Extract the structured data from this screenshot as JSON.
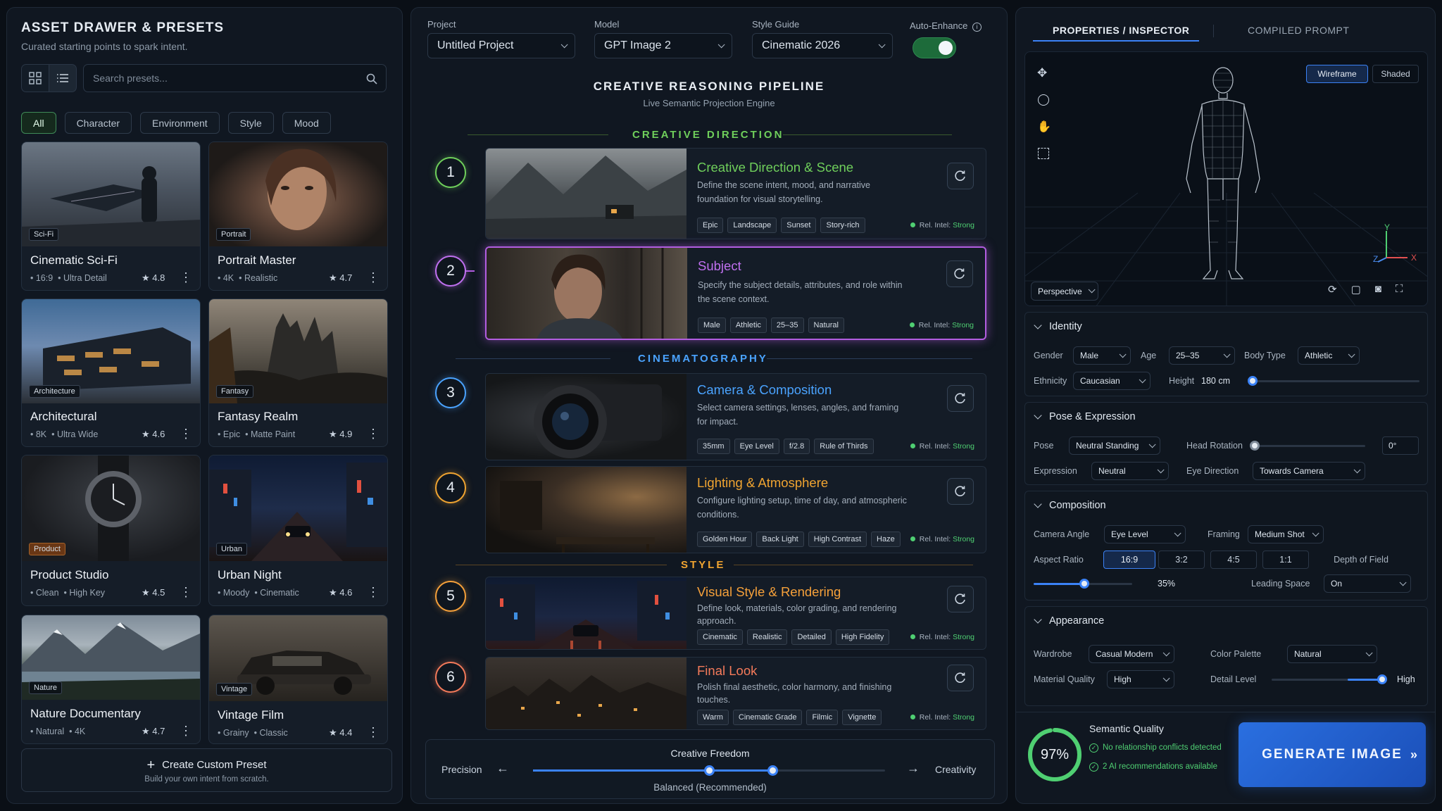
{
  "left": {
    "title": "ASSET DRAWER & PRESETS",
    "subtitle": "Curated starting points to spark intent.",
    "search_placeholder": "Search presets...",
    "filters": [
      "All",
      "Character",
      "Environment",
      "Style",
      "Mood"
    ],
    "presets": [
      {
        "tag": "Sci-Fi",
        "title": "Cinematic Sci-Fi",
        "meta1": "16:9",
        "meta2": "Ultra Detail",
        "rating": "4.8"
      },
      {
        "tag": "Portrait",
        "title": "Portrait Master",
        "meta1": "4K",
        "meta2": "Realistic",
        "rating": "4.7"
      },
      {
        "tag": "Architecture",
        "title": "Architectural",
        "meta1": "8K",
        "meta2": "Ultra Wide",
        "rating": "4.6"
      },
      {
        "tag": "Fantasy",
        "title": "Fantasy Realm",
        "meta1": "Epic",
        "meta2": "Matte Paint",
        "rating": "4.9"
      },
      {
        "tag": "Product",
        "title": "Product Studio",
        "meta1": "Clean",
        "meta2": "High Key",
        "rating": "4.5"
      },
      {
        "tag": "Urban",
        "title": "Urban Night",
        "meta1": "Moody",
        "meta2": "Cinematic",
        "rating": "4.6"
      },
      {
        "tag": "Nature",
        "title": "Nature Documentary",
        "meta1": "Natural",
        "meta2": "4K",
        "rating": "4.7"
      },
      {
        "tag": "Vintage",
        "title": "Vintage Film",
        "meta1": "Grainy",
        "meta2": "Classic",
        "rating": "4.4"
      }
    ],
    "create_title": "Create Custom Preset",
    "create_sub": "Build your own intent from scratch."
  },
  "mid": {
    "labels": {
      "project": "Project",
      "model": "Model",
      "style": "Style Guide",
      "auto": "Auto-Enhance"
    },
    "values": {
      "project": "Untitled Project",
      "model": "GPT Image 2",
      "style": "Cinematic 2026"
    },
    "auto_enhance_on": true,
    "title": "CREATIVE REASONING PIPELINE",
    "subtitle": "Live Semantic Projection Engine",
    "sections": [
      "CREATIVE DIRECTION",
      "CINEMATOGRAPHY",
      "STYLE"
    ],
    "rel_prefix": "Rel. Intel:",
    "steps": [
      {
        "n": "1",
        "title": "Creative Direction & Scene",
        "desc": "Define the scene intent, mood, and narrative foundation for visual storytelling.",
        "chips": [
          "Epic",
          "Landscape",
          "Sunset",
          "Story-rich"
        ],
        "rel": "Strong",
        "color": "#6fcf5b"
      },
      {
        "n": "2",
        "title": "Subject",
        "desc": "Specify the subject details, attributes, and role within the scene context.",
        "chips": [
          "Male",
          "Athletic",
          "25–35",
          "Natural"
        ],
        "rel": "Strong",
        "color": "#c070f0"
      },
      {
        "n": "3",
        "title": "Camera & Composition",
        "desc": "Select camera settings, lenses, angles, and framing for impact.",
        "chips": [
          "35mm",
          "Eye Level",
          "f/2.8",
          "Rule of Thirds"
        ],
        "rel": "Strong",
        "color": "#4aa3ff"
      },
      {
        "n": "4",
        "title": "Lighting & Atmosphere",
        "desc": "Configure lighting setup, time of day, and atmospheric conditions.",
        "chips": [
          "Golden Hour",
          "Back Light",
          "High Contrast",
          "Haze"
        ],
        "rel": "Strong",
        "color": "#f0a431"
      },
      {
        "n": "5",
        "title": "Visual Style & Rendering",
        "desc": "Define look, materials, color grading, and rendering approach.",
        "chips": [
          "Cinematic",
          "Realistic",
          "Detailed",
          "High Fidelity"
        ],
        "rel": "Strong",
        "color": "#f5a03a"
      },
      {
        "n": "6",
        "title": "Final Look",
        "desc": "Polish final aesthetic, color harmony, and finishing touches.",
        "chips": [
          "Warm",
          "Cinematic Grade",
          "Filmic",
          "Vignette"
        ],
        "rel": "Strong",
        "color": "#f47a5a"
      }
    ],
    "slider": {
      "title": "Creative Freedom",
      "left": "Precision",
      "right": "Creativity",
      "caption": "Balanced (Recommended)"
    }
  },
  "right": {
    "tabs": [
      "PROPERTIES / INSPECTOR",
      "COMPILED PROMPT"
    ],
    "view_modes": [
      "Wireframe",
      "Shaded"
    ],
    "perspective": "Perspective",
    "axes": {
      "x": "X",
      "y": "Y",
      "z": "Z"
    },
    "identity": {
      "title": "Identity",
      "gender_l": "Gender",
      "gender": "Male",
      "age_l": "Age",
      "age": "25–35",
      "body_l": "Body Type",
      "body": "Athletic",
      "eth_l": "Ethnicity",
      "eth": "Caucasian",
      "height_l": "Height",
      "height": "180 cm"
    },
    "pose": {
      "title": "Pose & Expression",
      "pose_l": "Pose",
      "pose": "Neutral Standing",
      "head_l": "Head Rotation",
      "head": "0°",
      "expr_l": "Expression",
      "expr": "Neutral",
      "eye_l": "Eye Direction",
      "eye": "Towards Camera"
    },
    "composition": {
      "title": "Composition",
      "angle_l": "Camera Angle",
      "angle": "Eye Level",
      "framing_l": "Framing",
      "framing": "Medium Shot",
      "ar_l": "Aspect Ratio",
      "ratios": [
        "16:9",
        "3:2",
        "4:5",
        "1:1"
      ],
      "dof": "Depth of Field",
      "zoom": "35%",
      "zoom_level": 0.35,
      "lead_l": "Leading Space",
      "lead": "On"
    },
    "appearance": {
      "title": "Appearance",
      "wardrobe_l": "Wardrobe",
      "wardrobe": "Casual Modern",
      "palette_l": "Color Palette",
      "palette": "Natural",
      "mq_l": "Material Quality",
      "mq": "High",
      "detail_l": "Detail Level",
      "detail": "High"
    },
    "quality": {
      "percent": "97%",
      "value": 0.97,
      "title": "Semantic Quality",
      "line1": "No relationship conflicts detected",
      "line2": "2 AI recommendations available"
    },
    "generate": "GENERATE IMAGE"
  }
}
